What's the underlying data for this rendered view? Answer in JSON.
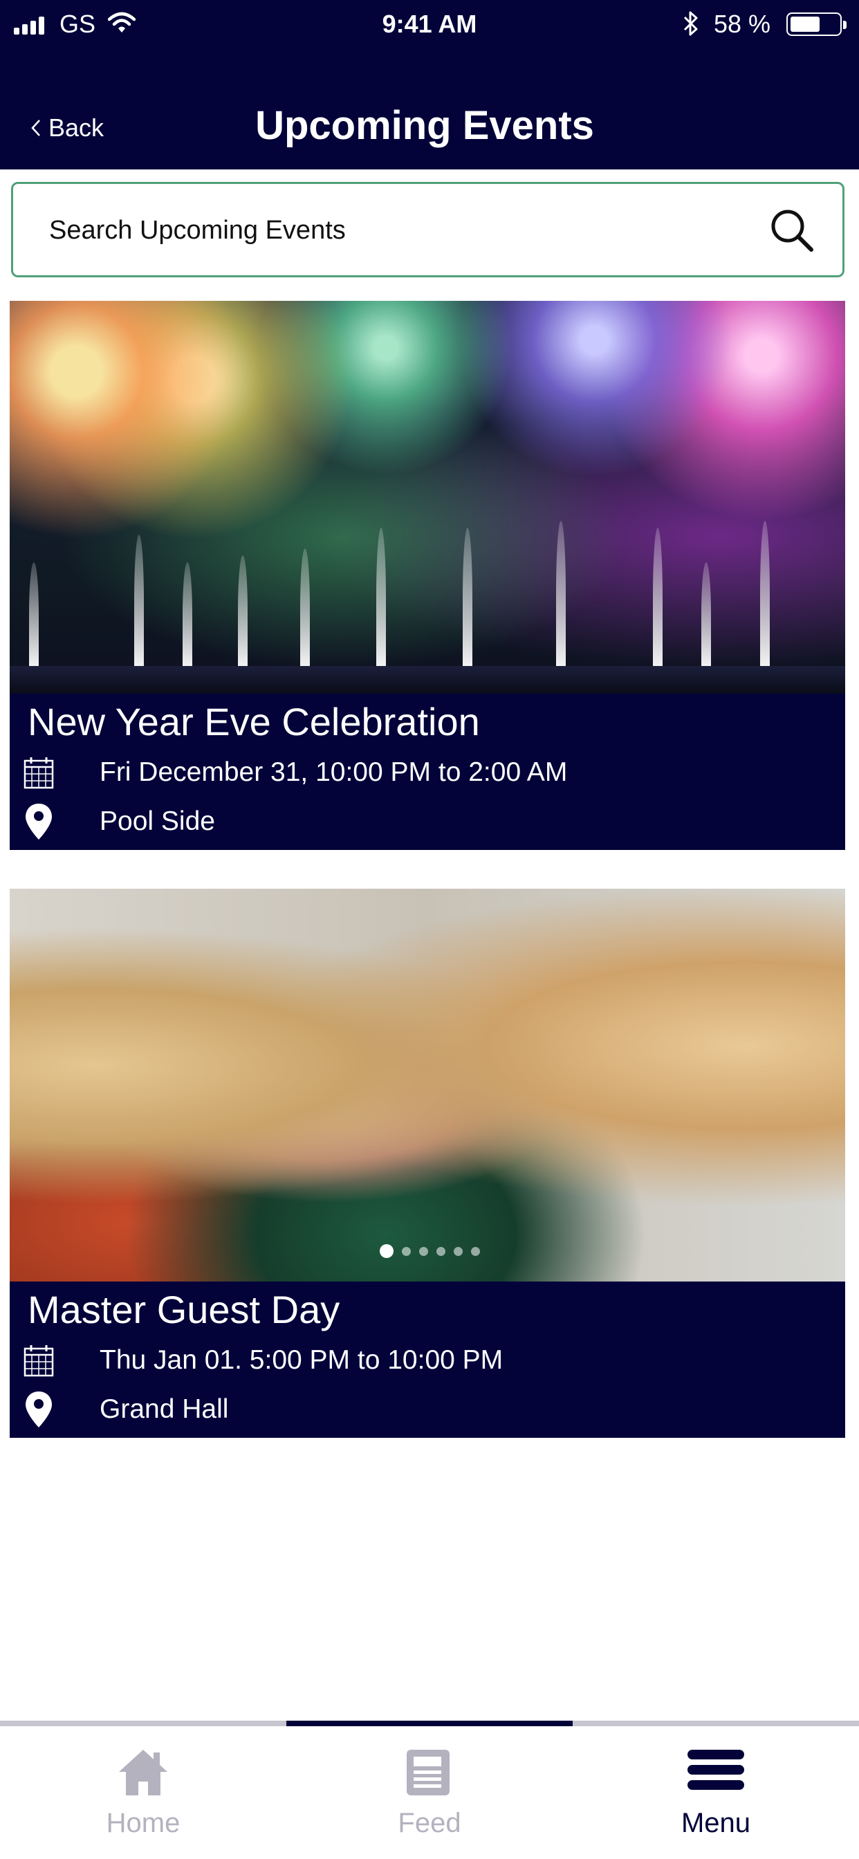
{
  "status_bar": {
    "carrier": "GS",
    "time": "9:41 AM",
    "battery": "58 %",
    "battery_level": 0.58
  },
  "header": {
    "back_label": "Back",
    "title": "Upcoming Events"
  },
  "search": {
    "placeholder": "Search Upcoming Events"
  },
  "events": [
    {
      "name": "New Year Eve Celebration",
      "date": "Fri December 31, 10:00 PM to 2:00 AM",
      "location": "Pool Side",
      "image": "fireworks-photo"
    },
    {
      "name": "Master Guest Day",
      "date": "Thu Jan 01. 5:00 PM to 10:00 PM",
      "location": "Grand Hall",
      "image": "guests-photo",
      "carousel": {
        "count": 6,
        "active": 1
      }
    }
  ],
  "tabbar": {
    "tabs": [
      {
        "label": "Home",
        "icon": "home-icon"
      },
      {
        "label": "Feed",
        "icon": "feed-icon"
      },
      {
        "label": "Menu",
        "icon": "menu-icon"
      }
    ],
    "active": "Menu"
  },
  "colors": {
    "navy": "#03033a",
    "search_border": "#4fa07a",
    "inactive_tab": "#b4b2bf"
  }
}
